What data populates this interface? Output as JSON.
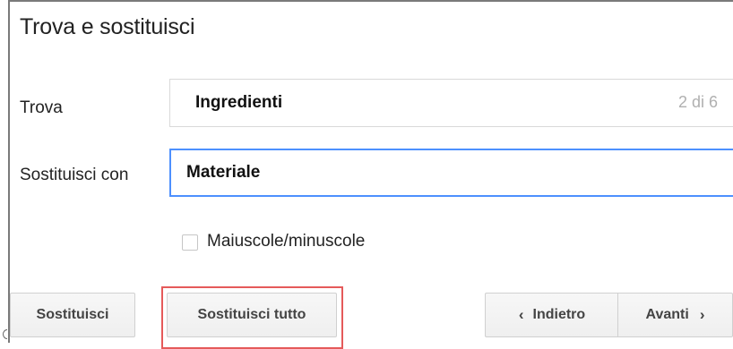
{
  "dialog": {
    "title": "Trova e sostituisci",
    "find": {
      "label": "Trova",
      "value": "Ingredienti",
      "match_count": "2 di 6"
    },
    "replace": {
      "label": "Sostituisci con",
      "value": "Materiale"
    },
    "match_case": {
      "label": "Maiuscole/minuscole",
      "checked": false
    },
    "buttons": {
      "replace": "Sostituisci",
      "replace_all": "Sostituisci tutto",
      "previous": "Indietro",
      "next": "Avanti"
    }
  },
  "colors": {
    "focus_border": "#4d90fe",
    "highlight_border": "#e55a5a",
    "count_text": "#b0b0b0"
  },
  "icons": {
    "previous": "chevron-left-icon",
    "next": "chevron-right-icon"
  }
}
